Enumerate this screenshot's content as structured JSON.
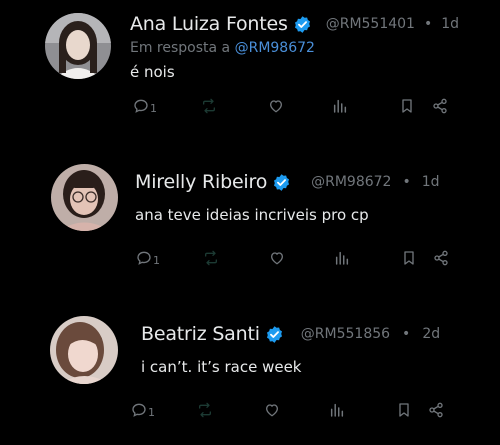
{
  "posts": [
    {
      "name": "Ana Luiza Fontes",
      "handle": "@RM551401",
      "separator": "•",
      "time": "1d",
      "reply_prefix": "Em resposta a ",
      "reply_to": "@RM98672",
      "text": "é nois",
      "reply_count": "1",
      "avatar_icon": "avatar-photo"
    },
    {
      "name": "Mirelly Ribeiro",
      "handle": "@RM98672",
      "separator": "•",
      "time": "1d",
      "text": "ana teve ideias incriveis pro cp",
      "reply_count": "1",
      "avatar_icon": "avatar-photo"
    },
    {
      "name": "Beatriz Santi",
      "handle": "@RM551856",
      "separator": "•",
      "time": "2d",
      "text": "i can’t. it’s race week",
      "reply_count": "1",
      "avatar_icon": "avatar-photo"
    }
  ],
  "colors": {
    "background": "#000000",
    "text": "#e7e9ea",
    "muted": "#71767b",
    "link": "#4a8fd9",
    "verified": "#1d9bf0"
  }
}
